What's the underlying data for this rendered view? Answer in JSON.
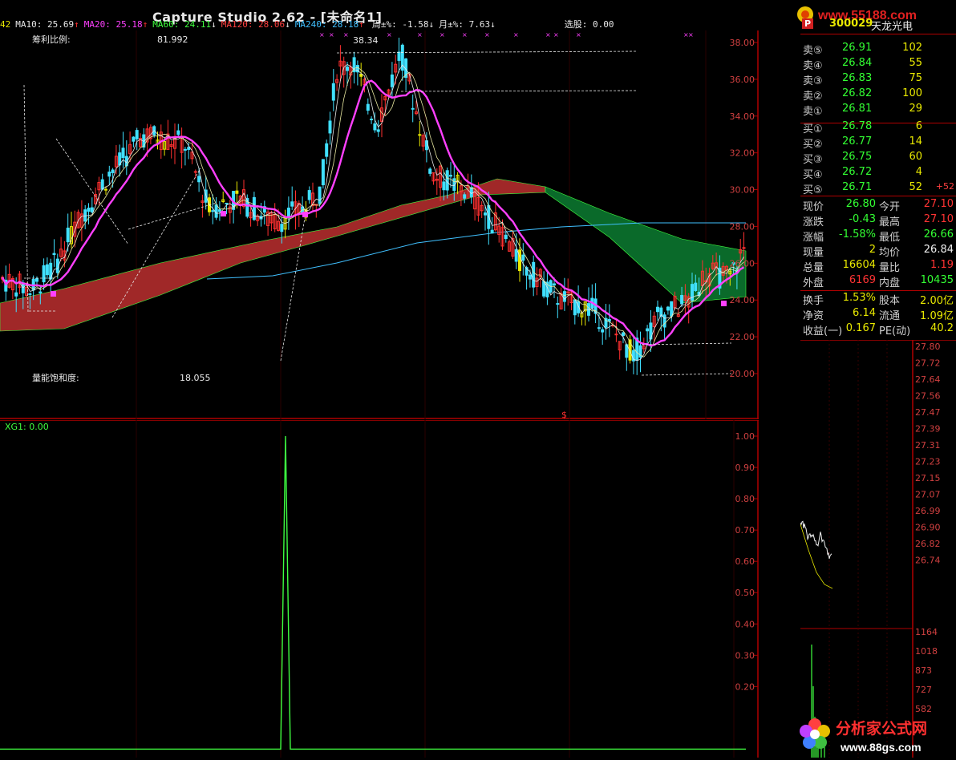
{
  "window": {
    "title": "Capture Studio 2.62 - [未命名1]"
  },
  "watermark_top": "www.55188.com",
  "indicators": [
    {
      "label": "42",
      "color": "#e8e800"
    },
    {
      "label": "MA10: 25.69",
      "color": "#e8e8e8",
      "arrow": "↑"
    },
    {
      "label": "MA20: 25.18",
      "color": "#ff40ff",
      "arrow": "↑"
    },
    {
      "label": "MA60: 24.11",
      "color": "#40ff40",
      "arrow": "↓"
    },
    {
      "label": "MA120: 28.06",
      "color": "#ff4040",
      "arrow": "↓"
    },
    {
      "label": "MA240: 28.18",
      "color": "#40c0ff",
      "arrow": "↑"
    },
    {
      "label": "周±%: -1.58",
      "color": "#e8e8e8",
      "arrow": "↓"
    },
    {
      "label": "月±%: 7.63",
      "color": "#e8e8e8",
      "arrow": "↓"
    },
    {
      "label": "选股: 0.00",
      "color": "#e8e8e8",
      "arrow": ""
    }
  ],
  "main_panel": {
    "profit_ratio_label": "筹利比例:",
    "profit_ratio_value": "81.992",
    "volume_saturation_label": "量能饱和度:",
    "volume_saturation_value": "18.055",
    "peak_label": "38.34",
    "y_ticks": [
      "38.00",
      "36.00",
      "34.00",
      "32.00",
      "30.00",
      "28.00",
      "26.00",
      "24.00",
      "22.00",
      "20.00"
    ],
    "marker_symbol": "$"
  },
  "sub_panel": {
    "label": "XG1: 0.00",
    "y_ticks": [
      "1.00",
      "0.90",
      "0.80",
      "0.70",
      "0.60",
      "0.50",
      "0.40",
      "0.30",
      "0.20"
    ]
  },
  "quote": {
    "badge": "P",
    "code": "300029",
    "name": "天龙光电",
    "asks": [
      {
        "label": "卖⑤",
        "price": "26.91",
        "vol": "102"
      },
      {
        "label": "卖④",
        "price": "26.84",
        "vol": "55"
      },
      {
        "label": "卖③",
        "price": "26.83",
        "vol": "75"
      },
      {
        "label": "卖②",
        "price": "26.82",
        "vol": "100"
      },
      {
        "label": "卖①",
        "price": "26.81",
        "vol": "29"
      }
    ],
    "bids": [
      {
        "label": "买①",
        "price": "26.78",
        "vol": "6",
        "chg": ""
      },
      {
        "label": "买②",
        "price": "26.77",
        "vol": "14",
        "chg": ""
      },
      {
        "label": "买③",
        "price": "26.75",
        "vol": "60",
        "chg": ""
      },
      {
        "label": "买④",
        "price": "26.72",
        "vol": "4",
        "chg": ""
      },
      {
        "label": "买⑤",
        "price": "26.71",
        "vol": "52",
        "chg": "+52"
      }
    ],
    "stats": [
      {
        "l1": "现价",
        "v1": "26.80",
        "c1": "green",
        "l2": "今开",
        "v2": "27.10",
        "c2": "red"
      },
      {
        "l1": "涨跌",
        "v1": "-0.43",
        "c1": "green",
        "l2": "最高",
        "v2": "27.10",
        "c2": "red"
      },
      {
        "l1": "涨幅",
        "v1": "-1.58%",
        "c1": "green",
        "l2": "最低",
        "v2": "26.66",
        "c2": "green"
      },
      {
        "l1": "现量",
        "v1": "2",
        "c1": "yellow",
        "l2": "均价",
        "v2": "26.84",
        "c2": "white"
      },
      {
        "l1": "总量",
        "v1": "16604",
        "c1": "yellow",
        "l2": "量比",
        "v2": "1.19",
        "c2": "red"
      },
      {
        "l1": "外盘",
        "v1": "6169",
        "c1": "red",
        "l2": "内盘",
        "v2": "10435",
        "c2": "green"
      }
    ],
    "finance": [
      {
        "l1": "换手",
        "v1": "1.53%",
        "l2": "股本",
        "v2": "2.00亿"
      },
      {
        "l1": "净资",
        "v1": "6.14",
        "l2": "流通",
        "v2": "1.09亿"
      },
      {
        "l1": "收益(一)",
        "v1": "0.167",
        "l2": "PE(动)",
        "v2": "40.2"
      }
    ]
  },
  "mini_panel": {
    "price_ticks": [
      "27.80",
      "27.72",
      "27.64",
      "27.56",
      "27.47",
      "27.39",
      "27.31",
      "27.23",
      "27.15",
      "27.07",
      "26.99",
      "26.90",
      "26.82",
      "26.74"
    ],
    "vol_ticks": [
      "1164",
      "1018",
      "873",
      "727",
      "582"
    ]
  },
  "watermark_bottom": {
    "name": "分析家公式网",
    "url": "www.88gs.com"
  },
  "colors": {
    "axis_red": "#b00000",
    "ma10": "#e8e8e8",
    "ma20": "#ff40ff",
    "band_red": "#a02828",
    "band_green": "#0a6a2a",
    "ma240": "#40c0ff",
    "up_candle": "#ff3030",
    "down_candle": "#40e0ff",
    "signal": "#40ff40"
  }
}
